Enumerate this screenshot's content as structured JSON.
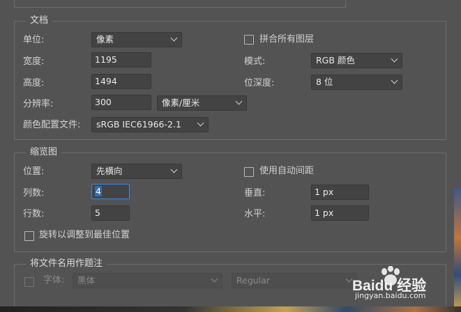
{
  "document": {
    "title": "文档",
    "unit": {
      "label": "单位:",
      "value": "像素"
    },
    "width": {
      "label": "宽度:",
      "value": "1195"
    },
    "height": {
      "label": "高度:",
      "value": "1494"
    },
    "resolution": {
      "label": "分辨率:",
      "value": "300",
      "unit": "像素/厘米"
    },
    "color_profile": {
      "label": "颜色配置文件:",
      "value": "sRGB IEC61966-2.1"
    },
    "flatten": {
      "label": "拼合所有图层",
      "checked": false
    },
    "mode": {
      "label": "模式:",
      "value": "RGB 颜色"
    },
    "bit_depth": {
      "label": "位深度:",
      "value": "8 位"
    }
  },
  "thumbnails": {
    "title": "缩览图",
    "position": {
      "label": "位置:",
      "value": "先横向"
    },
    "columns": {
      "label": "列数:",
      "value": "4"
    },
    "rows": {
      "label": "行数:",
      "value": "5"
    },
    "rotate": {
      "label": "旋转以调整到最佳位置",
      "checked": false
    },
    "auto_spacing": {
      "label": "使用自动间距",
      "checked": false
    },
    "vertical": {
      "label": "垂直:",
      "value": "1 px"
    },
    "horizontal": {
      "label": "水平:",
      "value": "1 px"
    }
  },
  "caption": {
    "title": "将文件名用作题注",
    "font": {
      "label": "字体:",
      "value": "黑体"
    },
    "style": {
      "value": "Regular"
    }
  },
  "watermark": {
    "text": "Baidu 经验",
    "sub": "jingyan.baidu.com"
  },
  "colors": {
    "background": "#535353",
    "focus": "#3b8bd8",
    "border": "#6e6e6e"
  }
}
